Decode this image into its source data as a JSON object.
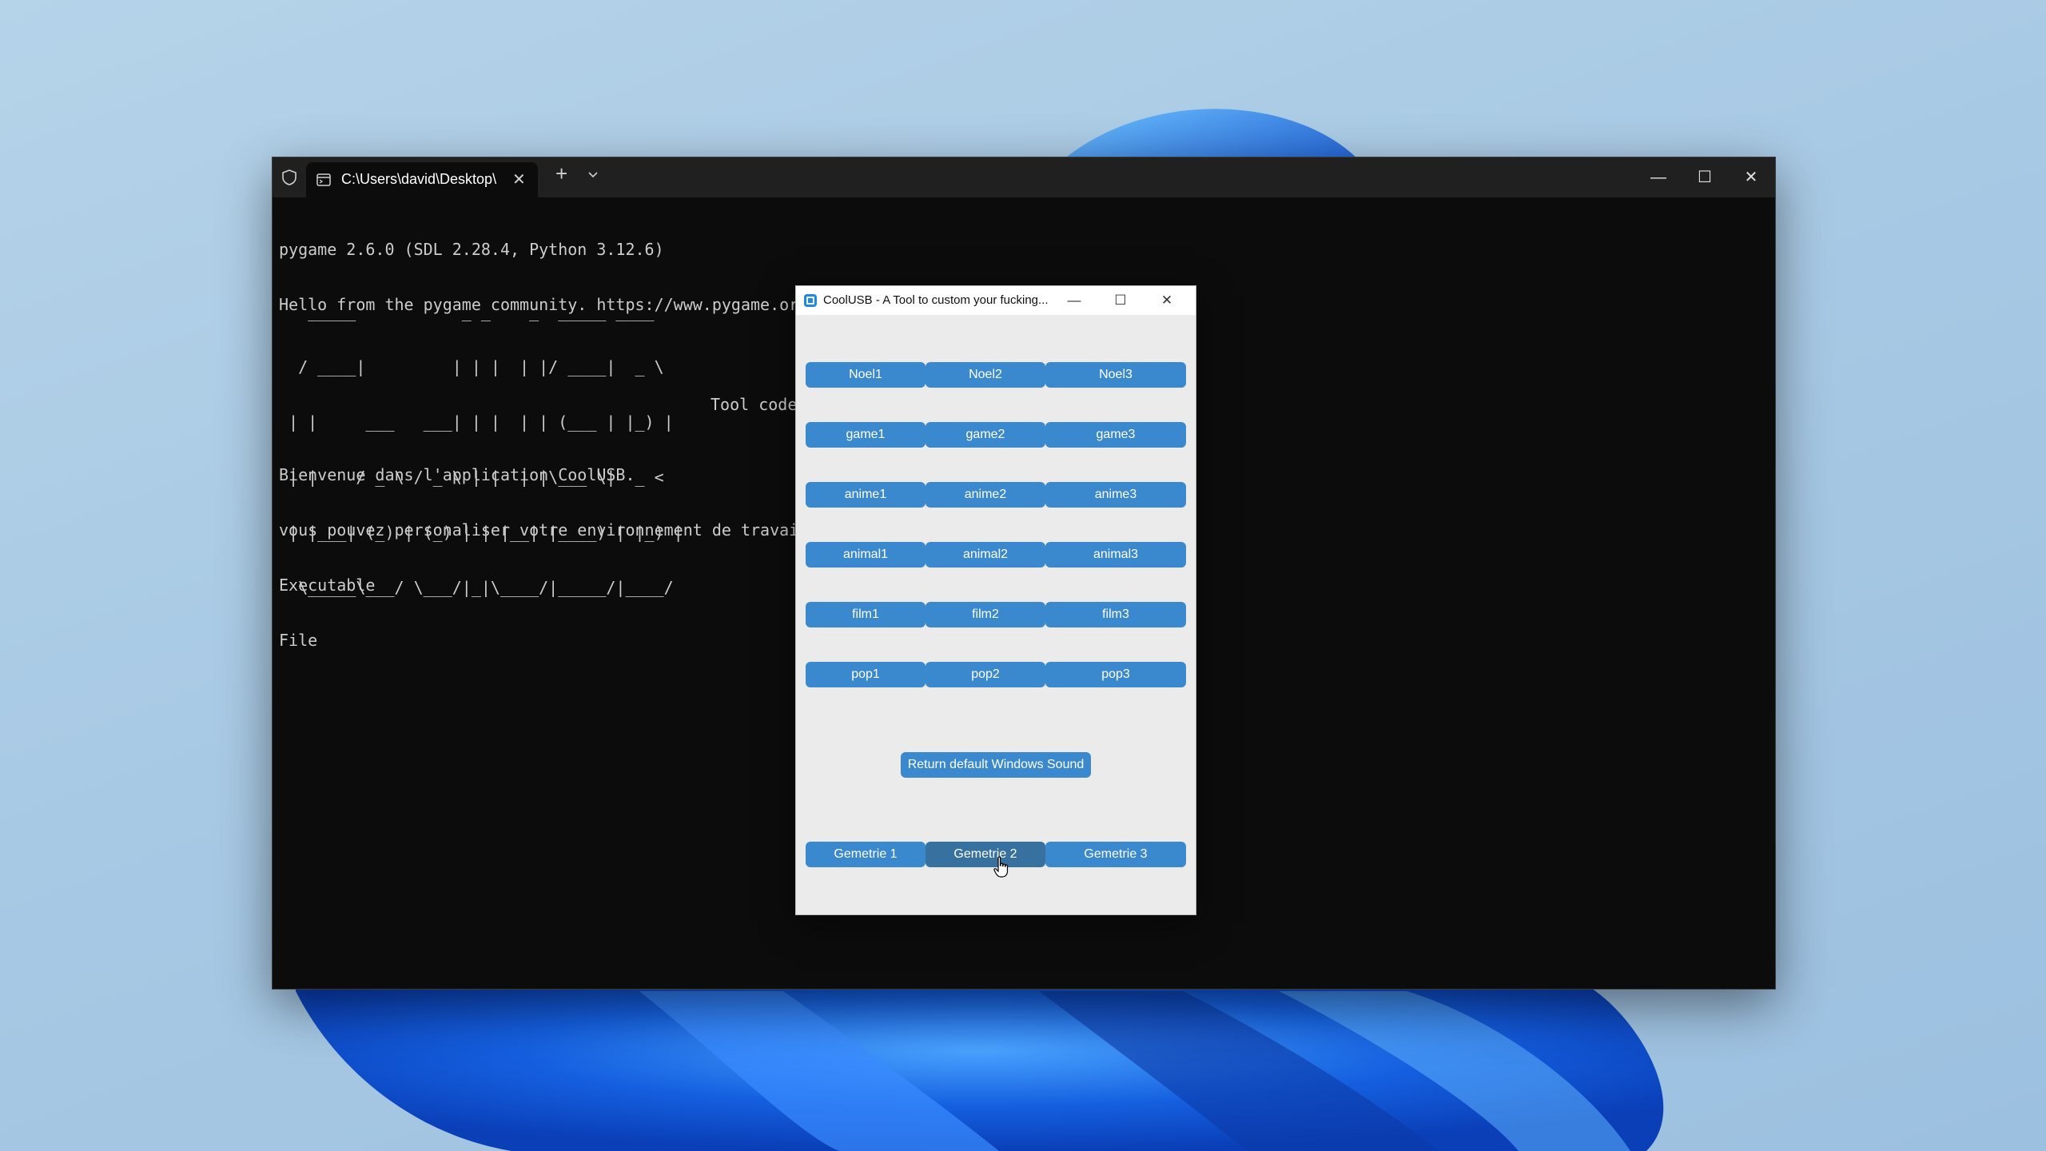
{
  "terminal": {
    "tab_title": "C:\\Users\\david\\Desktop\\",
    "icons": [
      "shield-icon",
      "terminal-icon",
      "close-icon",
      "plus-icon",
      "chevron-down-icon",
      "minimize-icon",
      "maximize-icon",
      "close-icon"
    ],
    "lines": [
      "pygame 2.6.0 (SDL 2.28.4, Python 3.12.6)",
      "Hello from the pygame community. https://www.pygame.org/contribute.html"
    ],
    "ascii_art": [
      "   _____           _ _    _  _____ ____  ",
      "  / ____|         | | |  | |/ ____|  _ \\ ",
      " | |     ___   ___| | |  | | (___ | |_) |",
      " | |    / _ \\ / _ \\ | |  | |\\___ \\|  _ < ",
      " | |___| (_) | (_) | | |__| |____) | |_) |",
      "  \\_____\\___/ \\___/|_|\\____/|_____/|____/ "
    ],
    "tool_code_text": "Tool code",
    "messages": [
      "Bienvenue dans l'application CoolUSB.",
      "vous pouvez personaliser votre environnement de travai",
      "Executable",
      "File"
    ]
  },
  "coolusb": {
    "title": "CoolUSB - A Tool to custom your fucking...",
    "rows": [
      [
        "Noel1",
        "Noel2",
        "Noel3"
      ],
      [
        "game1",
        "game2",
        "game3"
      ],
      [
        "anime1",
        "anime2",
        "anime3"
      ],
      [
        "animal1",
        "animal2",
        "animal3"
      ],
      [
        "film1",
        "film2",
        "film3"
      ],
      [
        "pop1",
        "pop2",
        "pop3"
      ]
    ],
    "default_sound_label": "Return default Windows Sound",
    "geometry": [
      "Gemetrie 1",
      "Gemetrie 2",
      "Gemetrie 3"
    ],
    "colors": {
      "button": "#3a89cf",
      "button_hover": "#36719f",
      "background": "#ebebeb"
    }
  }
}
